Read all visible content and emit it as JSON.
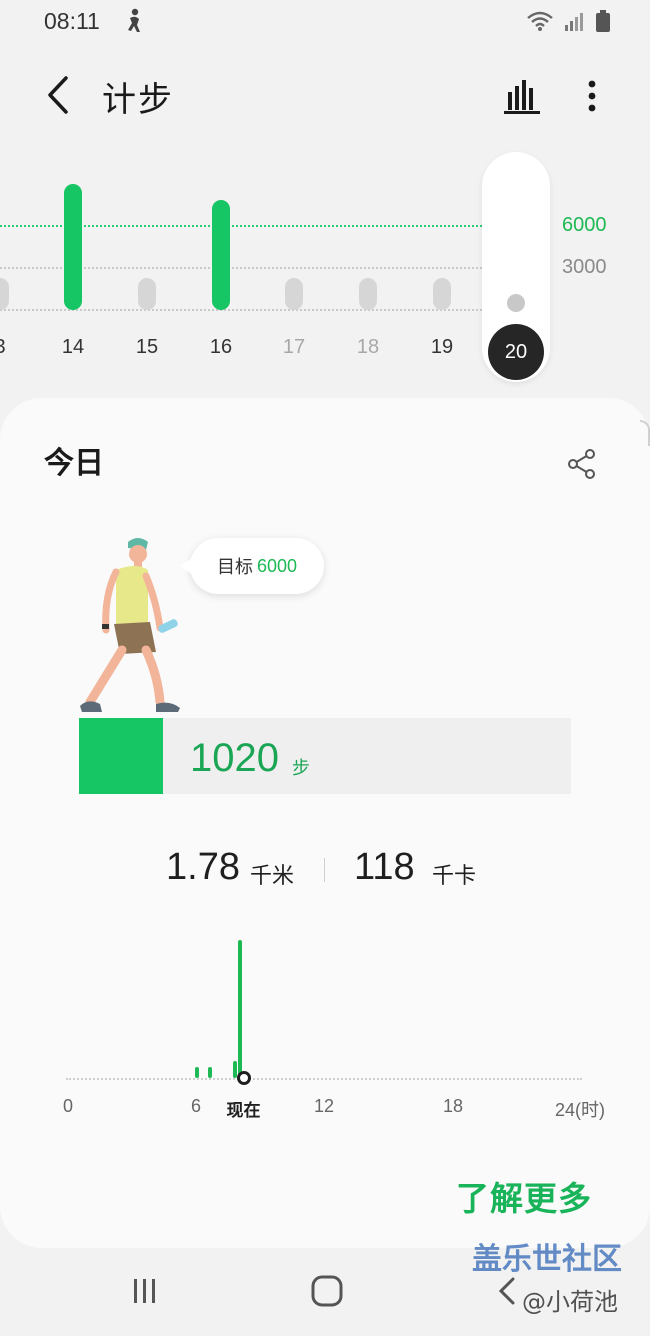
{
  "status_bar": {
    "time": "08:11"
  },
  "header": {
    "title": "计步"
  },
  "week_chart": {
    "goal_label": "6000",
    "mid_label": "3000",
    "days": [
      {
        "label": "3",
        "level": "small",
        "active": true
      },
      {
        "label": "14",
        "level": "high",
        "active": true
      },
      {
        "label": "15",
        "level": "small",
        "active": true
      },
      {
        "label": "16",
        "level": "goal",
        "active": true
      },
      {
        "label": "17",
        "level": "small",
        "active": false
      },
      {
        "label": "18",
        "level": "small",
        "active": false
      },
      {
        "label": "19",
        "level": "small",
        "active": true
      }
    ],
    "selected_day": "20",
    "colors": {
      "accent": "#16c563",
      "inactive_bar": "#d6d6d6",
      "selected": "#262626"
    }
  },
  "today": {
    "title": "今日",
    "goal_label": "目标",
    "goal_value": "6000",
    "steps": "1020",
    "steps_unit": "步",
    "progress_fraction": 0.17,
    "distance": "1.78",
    "distance_unit": "千米",
    "calories": "118",
    "calories_unit": "千卡"
  },
  "hourly_chart": {
    "axis_labels": [
      "0",
      "6",
      "现在",
      "12",
      "18",
      "24(时)"
    ],
    "current_hour": 8.18,
    "bars": [
      {
        "hour": 6.0,
        "level": 0.08
      },
      {
        "hour": 6.6,
        "level": 0.08
      },
      {
        "hour": 7.8,
        "level": 0.12
      },
      {
        "hour": 8.0,
        "level": 1.0
      }
    ]
  },
  "learn_more": "了解更多",
  "watermark": {
    "title": "盖乐世社区",
    "user": "@小荷池"
  }
}
